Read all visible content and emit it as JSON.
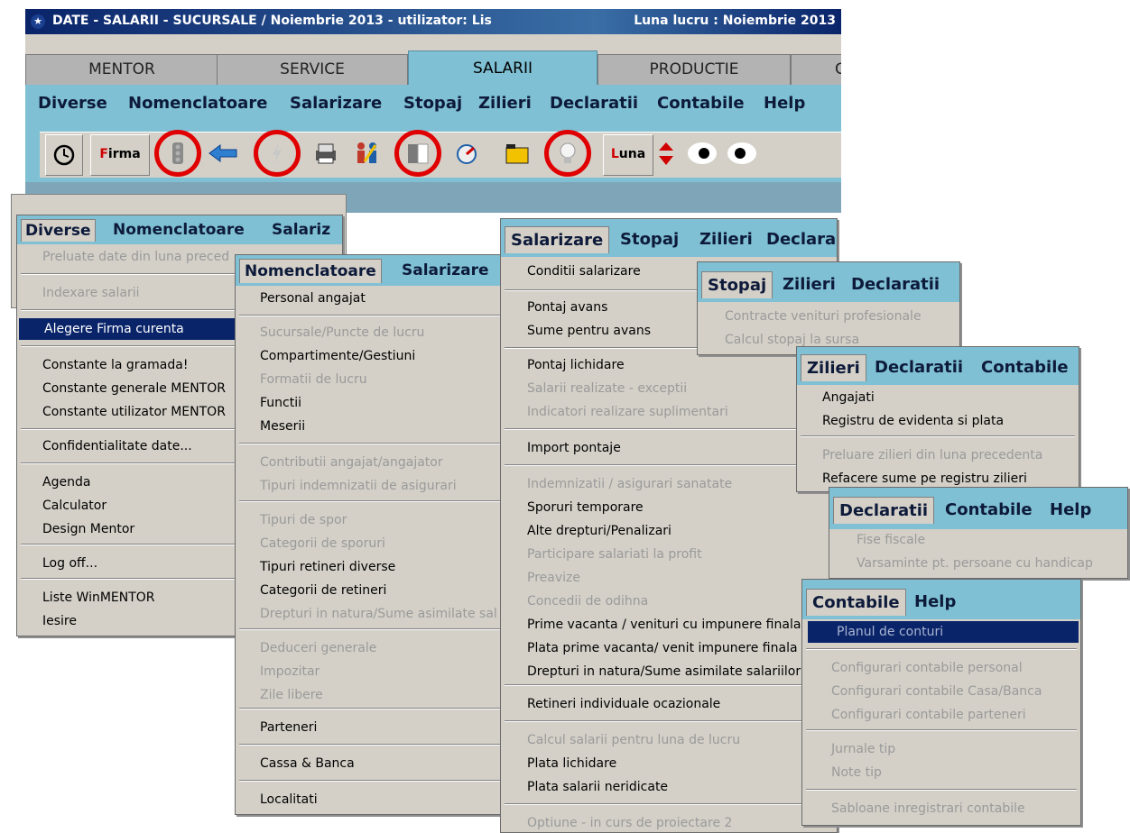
{
  "window": {
    "title": "DATE - SALARII - SUCURSALE / Noiembrie 2013 - utilizator: Lis",
    "luna_lucru": "Luna lucru : Noiembrie 2013"
  },
  "tabs": [
    "MENTOR",
    "SERVICE",
    "SALARII",
    "PRODUCTIE",
    "C"
  ],
  "active_tab": "SALARII",
  "menubar": [
    "Diverse",
    "Nomenclatoare",
    "Salarizare",
    "Stopaj",
    "Zilieri",
    "Declaratii",
    "Contabile",
    "Help"
  ],
  "toolbar": {
    "firma_label_first": "F",
    "firma_label_rest": "irma",
    "luna_label_first": "L",
    "luna_label_rest": "una",
    "icons": [
      "clock-icon",
      "firma-button",
      "traffic-light-icon",
      "arrow-back-icon",
      "lightning-icon",
      "printer-icon",
      "people-icon",
      "panel-icon",
      "gauge-icon",
      "folder-icon",
      "lightbulb-icon",
      "luna-button",
      "up-down-icon",
      "eye-icon",
      "eye-icon"
    ],
    "highlight_color": "#e00000"
  },
  "menus": {
    "diverse": {
      "bar": [
        "Diverse",
        "Nomenclatoare",
        "Salariz"
      ],
      "items": [
        {
          "label": "Preluate date din luna preced",
          "state": "disabled"
        },
        {
          "label": "Indexare salarii",
          "state": "disabled"
        },
        {
          "label": "Alegere Firma curenta",
          "state": "highlighted"
        },
        {
          "label": "Constante la gramada!",
          "state": "enabled"
        },
        {
          "label": "Constante generale MENTOR",
          "state": "enabled"
        },
        {
          "label": "Constante utilizator MENTOR",
          "state": "enabled"
        },
        {
          "label": "Confidentialitate date...",
          "state": "enabled"
        },
        {
          "label": "Agenda",
          "state": "enabled"
        },
        {
          "label": "Calculator",
          "state": "enabled"
        },
        {
          "label": "Design Mentor",
          "state": "enabled"
        },
        {
          "label": "Log off...",
          "state": "enabled"
        },
        {
          "label": "Liste WinMENTOR",
          "state": "enabled"
        },
        {
          "label": "Iesire",
          "state": "enabled"
        }
      ]
    },
    "nomenclatoare": {
      "bar": [
        "Nomenclatoare",
        "Salarizare"
      ],
      "items": [
        {
          "label": "Personal angajat",
          "state": "enabled"
        },
        {
          "label": "Sucursale/Puncte de lucru",
          "state": "disabled"
        },
        {
          "label": "Compartimente/Gestiuni",
          "state": "enabled"
        },
        {
          "label": "Formatii de lucru",
          "state": "disabled"
        },
        {
          "label": "Functii",
          "state": "enabled"
        },
        {
          "label": "Meserii",
          "state": "enabled"
        },
        {
          "label": "Contributii angajat/angajator",
          "state": "disabled"
        },
        {
          "label": "Tipuri indemnizatii de asigurari",
          "state": "disabled"
        },
        {
          "label": "Tipuri de spor",
          "state": "disabled"
        },
        {
          "label": "Categorii de sporuri",
          "state": "disabled"
        },
        {
          "label": "Tipuri retineri diverse",
          "state": "enabled"
        },
        {
          "label": "Categorii de retineri",
          "state": "enabled"
        },
        {
          "label": "Drepturi in natura/Sume asimilate sal",
          "state": "disabled"
        },
        {
          "label": "Deduceri generale",
          "state": "disabled"
        },
        {
          "label": "Impozitar",
          "state": "disabled"
        },
        {
          "label": "Zile libere",
          "state": "disabled"
        },
        {
          "label": "Parteneri",
          "state": "enabled"
        },
        {
          "label": "Cassa & Banca",
          "state": "enabled"
        },
        {
          "label": "Localitati",
          "state": "enabled"
        }
      ]
    },
    "salarizare": {
      "bar": [
        "Salarizare",
        "Stopaj",
        "Zilieri",
        "Declara"
      ],
      "items": [
        {
          "label": "Conditii salarizare",
          "state": "enabled"
        },
        {
          "label": "Pontaj avans",
          "state": "enabled"
        },
        {
          "label": "Sume pentru avans",
          "state": "enabled"
        },
        {
          "label": "Pontaj lichidare",
          "state": "enabled"
        },
        {
          "label": "Salarii realizate - exceptii",
          "state": "disabled"
        },
        {
          "label": "Indicatori realizare suplimentari",
          "state": "disabled"
        },
        {
          "label": "Import pontaje",
          "state": "enabled"
        },
        {
          "label": "Indemnizatii / asigurari sanatate",
          "state": "disabled"
        },
        {
          "label": "Sporuri temporare",
          "state": "enabled"
        },
        {
          "label": "Alte drepturi/Penalizari",
          "state": "enabled"
        },
        {
          "label": "Participare salariati la profit",
          "state": "disabled"
        },
        {
          "label": "Preavize",
          "state": "disabled"
        },
        {
          "label": "Concedii de odihna",
          "state": "disabled"
        },
        {
          "label": "Prime vacanta / venituri cu impunere finala",
          "state": "enabled"
        },
        {
          "label": "Plata prime vacanta/ venit impunere finala",
          "state": "enabled"
        },
        {
          "label": "Drepturi in natura/Sume asimilate salariilor",
          "state": "enabled"
        },
        {
          "label": "Retineri individuale ocazionale",
          "state": "enabled"
        },
        {
          "label": "Calcul salarii pentru luna de lucru",
          "state": "disabled"
        },
        {
          "label": "Plata lichidare",
          "state": "enabled"
        },
        {
          "label": "Plata salarii neridicate",
          "state": "enabled"
        },
        {
          "label": "Optiune - in curs de proiectare 2",
          "state": "disabled"
        }
      ]
    },
    "stopaj": {
      "bar": [
        "Stopaj",
        "Zilieri",
        "Declaratii"
      ],
      "items": [
        {
          "label": "Contracte venituri profesionale",
          "state": "disabled"
        },
        {
          "label": "Calcul stopaj la sursa",
          "state": "disabled"
        }
      ]
    },
    "zilieri": {
      "bar": [
        "Zilieri",
        "Declaratii",
        "Contabile"
      ],
      "items": [
        {
          "label": "Angajati",
          "state": "enabled"
        },
        {
          "label": "Registru de evidenta si plata",
          "state": "enabled"
        },
        {
          "label": "Preluare zilieri din luna precedenta",
          "state": "disabled"
        },
        {
          "label": "Refacere sume pe registru zilieri",
          "state": "enabled"
        }
      ]
    },
    "declaratii": {
      "bar": [
        "Declaratii",
        "Contabile",
        "Help"
      ],
      "items": [
        {
          "label": "Fise fiscale",
          "state": "disabled"
        },
        {
          "label": "Varsaminte pt. persoane cu handicap",
          "state": "disabled"
        }
      ]
    },
    "contabile": {
      "bar": [
        "Contabile",
        "Help"
      ],
      "items": [
        {
          "label": "Planul de conturi",
          "state": "highlighted-disabled"
        },
        {
          "label": "Configurari contabile personal",
          "state": "disabled"
        },
        {
          "label": "Configurari contabile Casa/Banca",
          "state": "disabled"
        },
        {
          "label": "Configurari contabile parteneri",
          "state": "disabled"
        },
        {
          "label": "Jurnale tip",
          "state": "disabled"
        },
        {
          "label": "Note tip",
          "state": "disabled"
        },
        {
          "label": "Sabloane inregistrari contabile",
          "state": "disabled"
        }
      ]
    }
  }
}
